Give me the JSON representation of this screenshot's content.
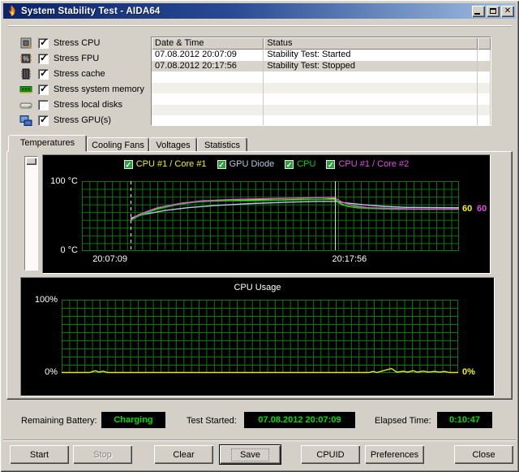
{
  "window": {
    "title": "System Stability Test - AIDA64"
  },
  "titlebar": {
    "icon": "aida64-flame-icon",
    "buttons": [
      {
        "name": "minimize-button",
        "glyph": "minimize"
      },
      {
        "name": "maximize-button",
        "glyph": "maximize"
      },
      {
        "name": "close-button",
        "glyph": "close"
      }
    ]
  },
  "stress_options": [
    {
      "label": "Stress CPU",
      "checked": true,
      "icon": "cpu-icon"
    },
    {
      "label": "Stress FPU",
      "checked": true,
      "icon": "fpu-icon"
    },
    {
      "label": "Stress cache",
      "checked": true,
      "icon": "cache-icon"
    },
    {
      "label": "Stress system memory",
      "checked": true,
      "icon": "memory-icon"
    },
    {
      "label": "Stress local disks",
      "checked": false,
      "icon": "disk-icon"
    },
    {
      "label": "Stress GPU(s)",
      "checked": true,
      "icon": "gpu-icon"
    }
  ],
  "log_table": {
    "columns": [
      "Date & Time",
      "Status"
    ],
    "rows": [
      {
        "datetime": "07.08.2012 20:07:09",
        "status": "Stability Test: Started"
      },
      {
        "datetime": "07.08.2012 20:17:56",
        "status": "Stability Test: Stopped"
      }
    ],
    "empty_row_count": 5
  },
  "tabs": [
    {
      "label": "Temperatures",
      "active": true
    },
    {
      "label": "Cooling Fans",
      "active": false
    },
    {
      "label": "Voltages",
      "active": false
    },
    {
      "label": "Statistics",
      "active": false
    }
  ],
  "chart_data": [
    {
      "type": "line",
      "title": "",
      "ylabel_top": "100 °C",
      "ylabel_bottom": "0 °C",
      "ylim": [
        0,
        100
      ],
      "grid": true,
      "legend_position": "top-center",
      "background": "#000000",
      "grid_color": "#0a7a0a",
      "x_axis_labels": [
        {
          "text": "20:07:09",
          "frac": 0.08
        },
        {
          "text": "20:17:56",
          "frac": 0.715
        }
      ],
      "event_lines": [
        {
          "frac": 0.129,
          "style": "dashed",
          "meaning": "test started"
        },
        {
          "frac": 0.671,
          "style": "solid",
          "meaning": "test stopped"
        }
      ],
      "series": [
        {
          "name": "CPU #1 / Core #1",
          "color": "#f2f200",
          "end_label": "60",
          "points": [
            [
              0.129,
              45
            ],
            [
              0.14,
              49
            ],
            [
              0.18,
              58
            ],
            [
              0.22,
              64
            ],
            [
              0.27,
              69
            ],
            [
              0.32,
              71
            ],
            [
              0.38,
              72
            ],
            [
              0.45,
              73
            ],
            [
              0.52,
              73
            ],
            [
              0.58,
              74
            ],
            [
              0.63,
              74
            ],
            [
              0.668,
              75
            ],
            [
              0.685,
              68
            ],
            [
              0.705,
              64
            ],
            [
              0.73,
              62
            ],
            [
              0.77,
              61
            ],
            [
              0.82,
              60
            ],
            [
              0.9,
              60
            ],
            [
              1,
              60
            ]
          ]
        },
        {
          "name": "GPU Diode",
          "color": "#b9c7e2",
          "end_label": null,
          "points": [
            [
              0.129,
              47
            ],
            [
              0.16,
              52
            ],
            [
              0.22,
              58
            ],
            [
              0.28,
              62
            ],
            [
              0.35,
              65
            ],
            [
              0.45,
              68
            ],
            [
              0.55,
              70
            ],
            [
              0.63,
              71
            ],
            [
              0.668,
              71
            ],
            [
              0.7,
              69
            ],
            [
              0.75,
              66
            ],
            [
              0.8,
              64
            ],
            [
              0.86,
              62.5
            ],
            [
              1,
              62
            ]
          ]
        },
        {
          "name": "CPU",
          "color": "#00d200",
          "end_label": null,
          "points": [
            [
              0.129,
              44
            ],
            [
              0.15,
              50
            ],
            [
              0.2,
              60
            ],
            [
              0.25,
              66
            ],
            [
              0.3,
              70
            ],
            [
              0.36,
              72
            ],
            [
              0.45,
              72
            ],
            [
              0.55,
              73
            ],
            [
              0.63,
              74
            ],
            [
              0.668,
              74
            ],
            [
              0.69,
              66
            ],
            [
              0.72,
              63
            ],
            [
              0.76,
              61
            ],
            [
              0.82,
              60
            ],
            [
              0.9,
              60
            ],
            [
              1,
              60
            ]
          ]
        },
        {
          "name": "CPU #1 / Core #2",
          "color": "#e050e0",
          "end_label": "60",
          "points": [
            [
              0.129,
              44
            ],
            [
              0.15,
              52
            ],
            [
              0.2,
              62
            ],
            [
              0.26,
              68
            ],
            [
              0.32,
              72
            ],
            [
              0.4,
              74
            ],
            [
              0.5,
              75
            ],
            [
              0.6,
              76
            ],
            [
              0.668,
              77
            ],
            [
              0.69,
              70
            ],
            [
              0.72,
              65
            ],
            [
              0.76,
              62
            ],
            [
              0.82,
              61
            ],
            [
              0.9,
              60
            ],
            [
              1,
              60
            ]
          ]
        }
      ]
    },
    {
      "type": "line",
      "title": "CPU Usage",
      "ylabel_top": "100%",
      "ylabel_bottom": "0%",
      "right_label": "0%",
      "right_label_color": "#f2f200",
      "ylim": [
        0,
        100
      ],
      "grid": true,
      "background": "#000000",
      "grid_color": "#0a7a0a",
      "series": [
        {
          "name": "CPU Usage",
          "color": "#e8e800",
          "points": [
            [
              0,
              0.6
            ],
            [
              0.07,
              0.6
            ],
            [
              0.085,
              3
            ],
            [
              0.095,
              1
            ],
            [
              0.105,
              2.5
            ],
            [
              0.115,
              0.6
            ],
            [
              0.3,
              0.6
            ],
            [
              0.6,
              0.6
            ],
            [
              0.775,
              0.6
            ],
            [
              0.785,
              2
            ],
            [
              0.795,
              0.6
            ],
            [
              0.832,
              6
            ],
            [
              0.845,
              1
            ],
            [
              0.862,
              2.2
            ],
            [
              0.872,
              1
            ],
            [
              0.887,
              3
            ],
            [
              0.897,
              1
            ],
            [
              0.912,
              2.5
            ],
            [
              0.925,
              1
            ],
            [
              0.94,
              2
            ],
            [
              0.952,
              1
            ],
            [
              0.966,
              2
            ],
            [
              0.978,
              0.6
            ],
            [
              1,
              0.6
            ]
          ]
        }
      ]
    }
  ],
  "status_bar": {
    "battery_label": "Remaining Battery:",
    "battery_value": "Charging",
    "test_started_label": "Test Started:",
    "test_started_value": "07.08.2012 20:07:09",
    "elapsed_label": "Elapsed Time:",
    "elapsed_value": "0:10:47",
    "value_color": "#00dd00"
  },
  "buttons": [
    {
      "label": "Start",
      "disabled": false,
      "focused": false
    },
    {
      "label": "Stop",
      "disabled": true,
      "focused": false
    },
    {
      "label": "Clear",
      "disabled": false,
      "focused": false
    },
    {
      "label": "Save",
      "disabled": false,
      "focused": true
    },
    {
      "label": "CPUID",
      "disabled": false,
      "focused": false
    },
    {
      "label": "Preferences",
      "disabled": false,
      "focused": false
    },
    {
      "label": "Close",
      "disabled": false,
      "focused": false
    }
  ]
}
